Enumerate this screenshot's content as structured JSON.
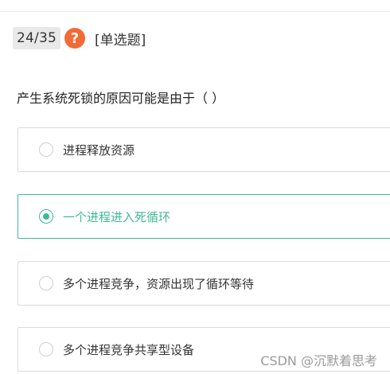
{
  "header": {
    "progress": "24/35",
    "help_icon_glyph": "?",
    "question_type": "[单选题]"
  },
  "question": {
    "stem": "产生系统死锁的原因可能是由于（   ）"
  },
  "options": [
    {
      "label": "进程释放资源",
      "selected": false
    },
    {
      "label": "一个进程进入死循环",
      "selected": true
    },
    {
      "label": "多个进程竞争，资源出现了循环等待",
      "selected": false
    },
    {
      "label": "多个进程竞争共享型设备",
      "selected": false
    }
  ],
  "watermark": "CSDN @沉默着思考",
  "colors": {
    "accent": "#3fb896",
    "help_icon": "#f26a35",
    "badge_bg": "#e9e9e9"
  }
}
